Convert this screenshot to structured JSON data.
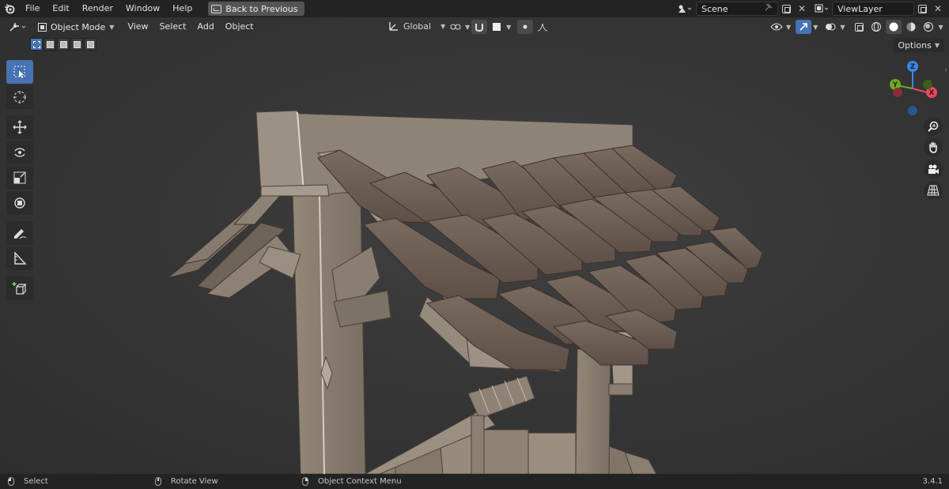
{
  "menubar": {
    "items": [
      "File",
      "Edit",
      "Render",
      "Window",
      "Help"
    ],
    "back_button": "Back to Previous",
    "scene": "Scene",
    "view_layer": "ViewLayer"
  },
  "viewport_header": {
    "mode": "Object Mode",
    "menus": [
      "View",
      "Select",
      "Add",
      "Object"
    ],
    "transform_orientation": "Global",
    "options": "Options"
  },
  "navigation_gizmo": {
    "axes": [
      "X",
      "Y",
      "Z"
    ],
    "colors": {
      "x": "#e8495f",
      "y": "#72a824",
      "z": "#3b86e8"
    }
  },
  "statusbar": {
    "select": "Select",
    "rotate": "Rotate View",
    "context_menu": "Object Context Menu",
    "version": "3.4.1"
  },
  "theme": {
    "accent": "#4772b3",
    "wood": "#8a7f73",
    "roof_tile": "#6d5d52"
  }
}
